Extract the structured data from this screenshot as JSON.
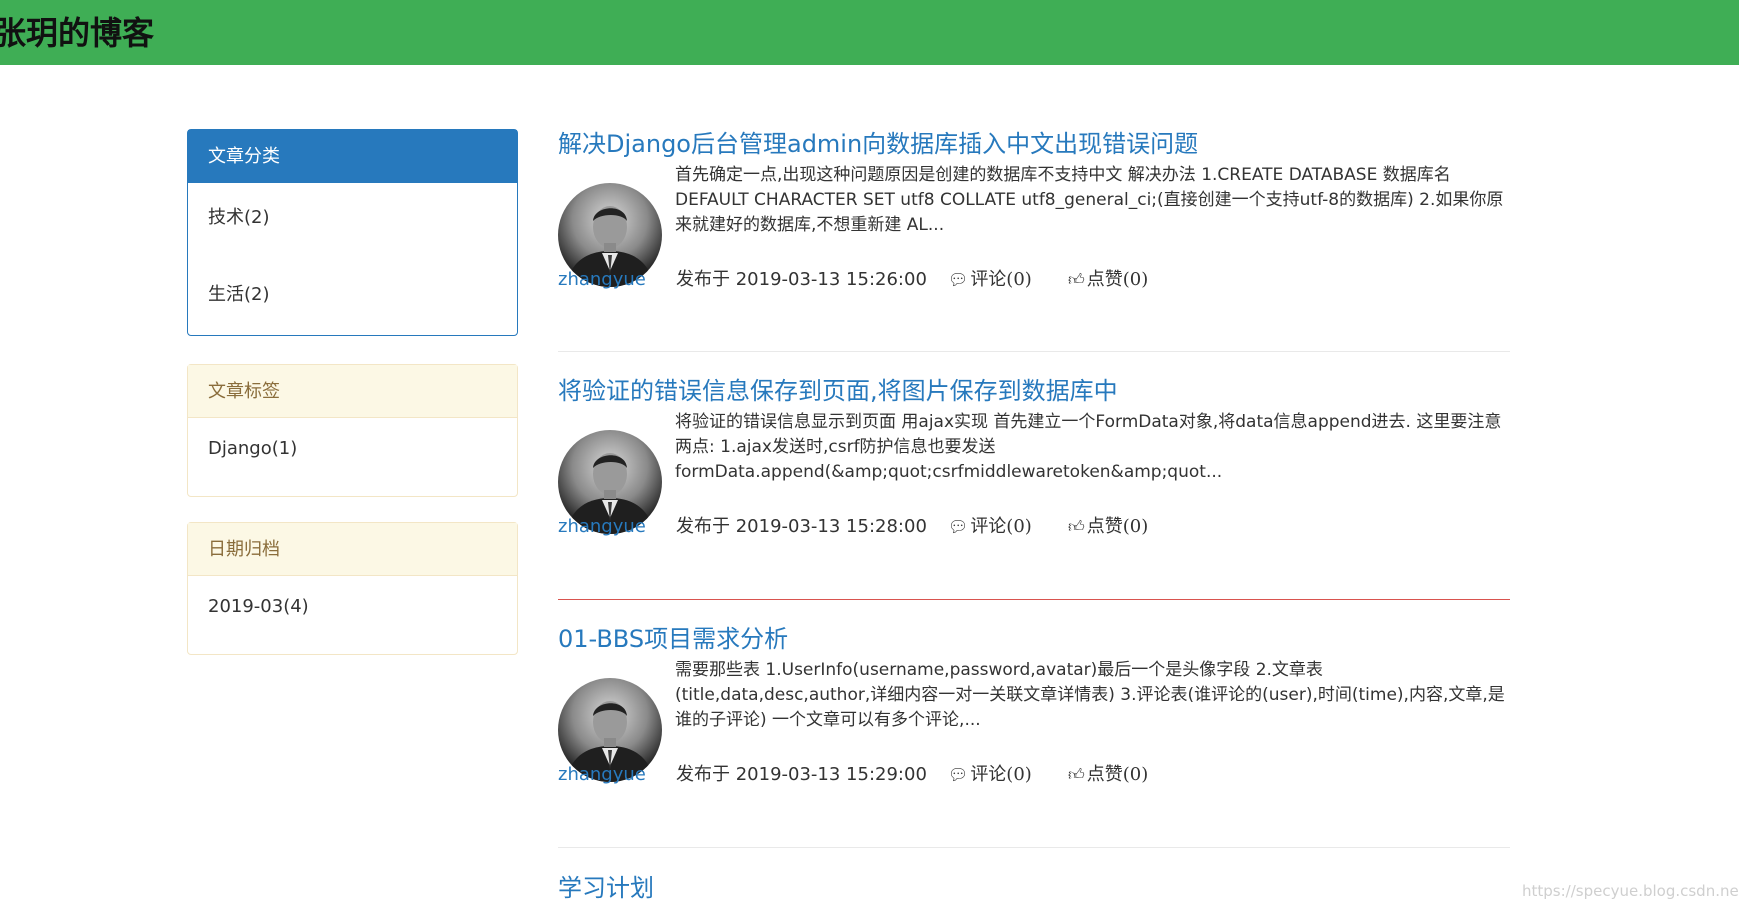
{
  "header": {
    "title": "张玥的博客",
    "bg_color": "#3fae55"
  },
  "sidebar": {
    "panels": [
      {
        "heading": "文章分类",
        "style": "primary",
        "items": [
          "技术(2)",
          "生活(2)"
        ]
      },
      {
        "heading": "文章标签",
        "style": "warning",
        "items": [
          "Django(1)"
        ]
      },
      {
        "heading": "日期归档",
        "style": "warning",
        "items": [
          "2019-03(4)"
        ]
      }
    ]
  },
  "articles": [
    {
      "title": "解决Django后台管理admin向数据库插入中文出现错误问题",
      "desc": "首先确定一点,出现这种问题原因是创建的数据库不支持中文 解决办法 1.CREATE DATABASE 数据库名 DEFAULT CHARACTER SET utf8 COLLATE utf8_general_ci;(直接创建一个支持utf-8的数据库) 2.如果你原来就建好的数据库,不想重新建 AL...",
      "author": "zhangyue",
      "published": "发布于 2019-03-13 15:26:00",
      "comments": "评论(0)",
      "likes": "点赞(0)"
    },
    {
      "title": "将验证的错误信息保存到页面,将图片保存到数据库中",
      "desc": "将验证的错误信息显示到页面 用ajax实现 首先建立一个FormData对象,将data信息append进去. 这里要注意两点: 1.ajax发送时,csrf防护信息也要发送 formData.append(&amp;quot;csrfmiddlewaretoken&amp;quot...",
      "author": "zhangyue",
      "published": "发布于 2019-03-13 15:28:00",
      "comments": "评论(0)",
      "likes": "点赞(0)"
    },
    {
      "title": "01-BBS项目需求分析",
      "desc": "需要那些表 1.UserInfo(username,password,avatar)最后一个是头像字段 2.文章表(title,data,desc,author,详细内容一对一关联文章详情表) 3.评论表(谁评论的(user),时间(time),内容,文章,是谁的子评论) 一个文章可以有多个评论,...",
      "author": "zhangyue",
      "published": "发布于 2019-03-13 15:29:00",
      "comments": "评论(0)",
      "likes": "点赞(0)"
    },
    {
      "title": "学习计划"
    }
  ],
  "watermark": "https://specyue.blog.csdn.net",
  "colors": {
    "link": "#2779bd",
    "primary": "#2779bd",
    "warning_bg": "#fcf8e5",
    "warning_text": "#8a6d3b",
    "divider_highlight": "#d9534f"
  },
  "icons": {
    "comment": "comment-icon",
    "like": "thumbs-up-icon"
  }
}
